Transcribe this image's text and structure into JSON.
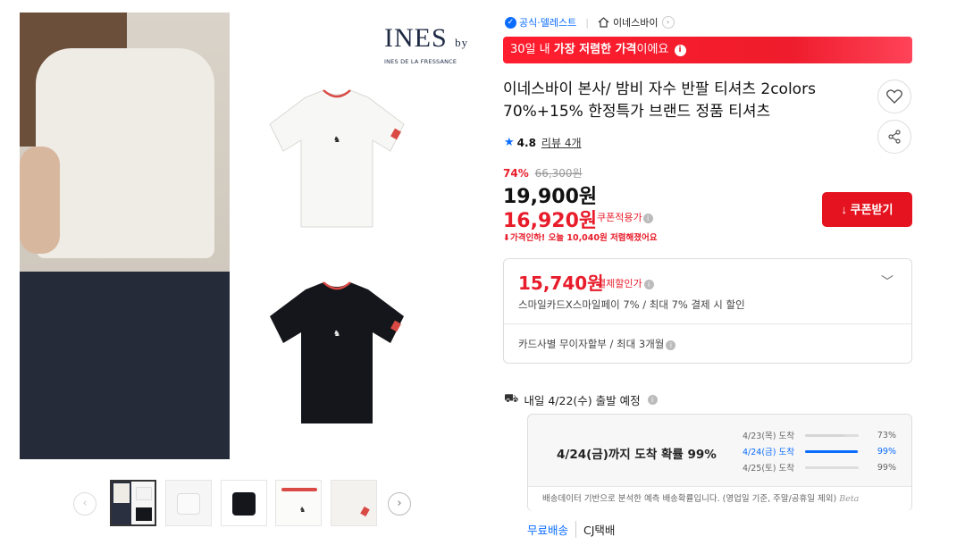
{
  "gallery": {
    "brand_logo_main": "INES",
    "brand_logo_by": "by",
    "brand_logo_sub": "INES DE LA FRESSANCE",
    "prev_icon": "chevron-left-icon",
    "next_icon": "chevron-right-icon",
    "thumbnails": [
      "thumb-1",
      "thumb-2",
      "thumb-3",
      "thumb-4",
      "thumb-5"
    ],
    "active_thumbnail": 0
  },
  "seller": {
    "official_label": "공식·델레스트",
    "store_name": "이네스바이"
  },
  "banner": {
    "prefix": "30일 내 ",
    "highlight": "가장 저렴한 가격",
    "suffix": "이에요",
    "info_icon": "i"
  },
  "product": {
    "title_line1": "이네스바이 본사/ 밤비 자수 반팔 티셔츠 2colors",
    "title_line2": "70%+15% 한정특가 브랜드 정품 티셔츠",
    "rating": "4.8",
    "reviews": "리뷰 4개"
  },
  "pricing": {
    "discount_rate": "74%",
    "original_price": "66,300원",
    "price": "19,900원",
    "coupon_price": "16,920원",
    "coupon_label": "쿠폰적용가",
    "drop_note": "가격인하! 오늘 10,040원 저렴해졌어요",
    "coupon_button": "쿠폰받기"
  },
  "payment": {
    "price": "15,740원",
    "label": "결제할인가",
    "description": "스마일카드X스마일페이 7% / 최대 7% 결제 시 할인",
    "installment": "카드사별 무이자할부 / 최대 3개월"
  },
  "delivery": {
    "ship_date": "내일 4/22(수) 출발 예정",
    "arrival_main": "4/24(금)까지 도착 확률 99%",
    "rows": [
      {
        "date": "4/23(목) 도착",
        "percent": "73%",
        "ratio": 0.73
      },
      {
        "date": "4/24(금) 도착",
        "percent": "99%",
        "ratio": 0.99
      },
      {
        "date": "4/25(토) 도착",
        "percent": "99%",
        "ratio": 0.0
      }
    ],
    "note": "배송데이터 기반으로 분석한 예측 배송확률입니다. (영업일 기준, 주말/공휴일 제외)",
    "beta": "Beta",
    "free_shipping": "무료배송",
    "carrier": "CJ택배"
  },
  "colors": {
    "accent_red": "#e4131f",
    "accent_blue": "#0a6cff"
  }
}
